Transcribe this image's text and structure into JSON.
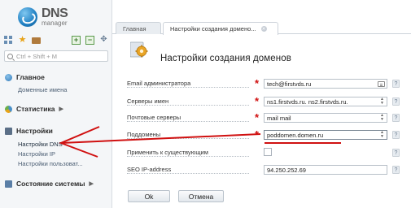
{
  "app": {
    "logo_main": "DNS",
    "logo_sub": "manager"
  },
  "toolbar": {
    "icons": [
      "grid-icon",
      "star-icon",
      "briefcase-icon",
      "expand-all-icon",
      "collapse-all-icon",
      "pin-icon"
    ]
  },
  "search": {
    "placeholder": "Ctrl + Shift + M"
  },
  "nav": {
    "main": {
      "label": "Главное",
      "items": [
        "Доменные имена"
      ]
    },
    "stats": {
      "label": "Статистика"
    },
    "settings": {
      "label": "Настройки",
      "items": [
        "Настройки DNS",
        "Настройки IP",
        "Настройки пользоват..."
      ]
    },
    "system": {
      "label": "Состояние системы"
    }
  },
  "tabs": [
    {
      "label": "Главная"
    },
    {
      "label": "Настройки создания домено..."
    }
  ],
  "form": {
    "title": "Настройки создания доменов",
    "fields": {
      "email": {
        "label": "Email администратора",
        "value": "tech@firstvds.ru"
      },
      "ns": {
        "label": "Серверы имен",
        "value": "ns1.firstvds.ru. ns2.firstvds.ru."
      },
      "mail": {
        "label": "Почтовые серверы",
        "value": "mail mail"
      },
      "subdomains": {
        "label": "Поддомены",
        "value": "poddomen.domen.ru"
      },
      "apply": {
        "label": "Применить к существующим"
      },
      "seo": {
        "label": "SEO IP-address",
        "value": "94.250.252.69"
      }
    },
    "help_glyph": "?",
    "required_glyph": "*",
    "buttons": {
      "ok": "Ok",
      "cancel": "Отмена"
    }
  },
  "colors": {
    "required": "#d01010",
    "annotation_arrow": "#d01010",
    "sidebar_bg": "#f4f6f8"
  }
}
